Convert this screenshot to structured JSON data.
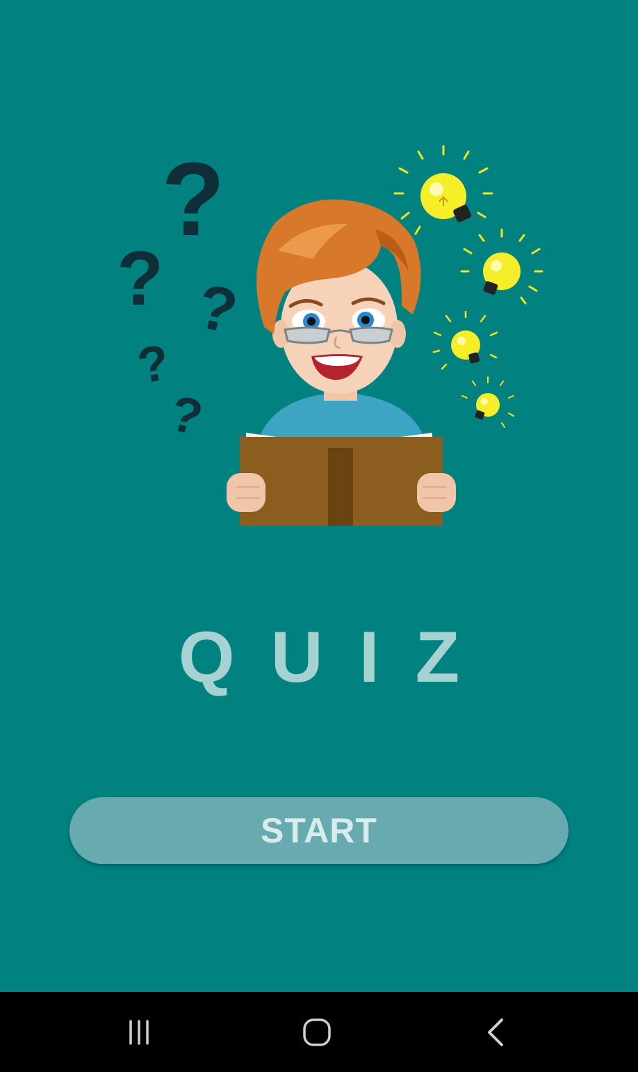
{
  "app": {
    "title": "QUIZ",
    "start_label": "START",
    "illustration": "teacher-reading-book-with-questions-and-ideas"
  },
  "colors": {
    "background": "#028181",
    "title": "#a6d2d2",
    "button_bg": "#67abb0",
    "button_text": "#d8ecec",
    "navbar": "#000000"
  },
  "navbar": {
    "buttons": [
      {
        "icon": "recent-apps-icon"
      },
      {
        "icon": "home-icon"
      },
      {
        "icon": "back-icon"
      }
    ]
  }
}
